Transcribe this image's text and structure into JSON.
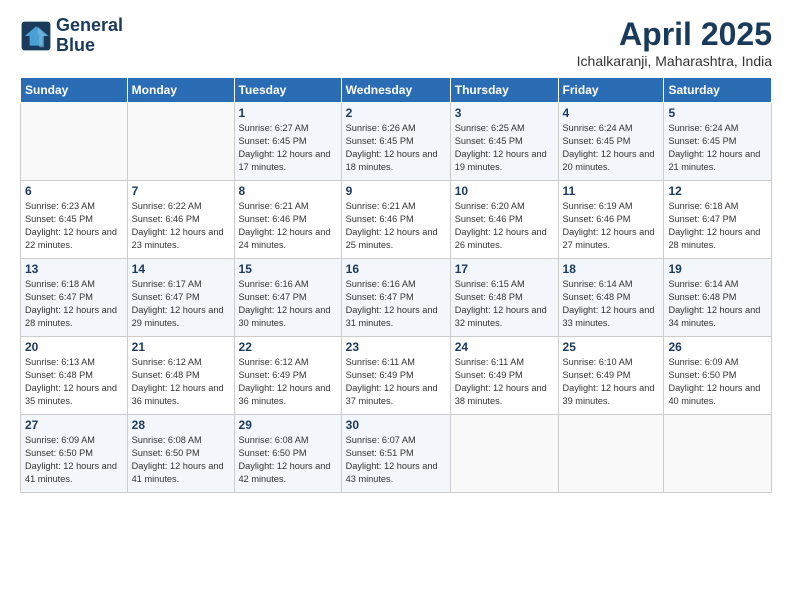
{
  "header": {
    "logo_line1": "General",
    "logo_line2": "Blue",
    "title": "April 2025",
    "subtitle": "Ichalkaranji, Maharashtra, India"
  },
  "days_of_week": [
    "Sunday",
    "Monday",
    "Tuesday",
    "Wednesday",
    "Thursday",
    "Friday",
    "Saturday"
  ],
  "weeks": [
    [
      {
        "num": "",
        "sunrise": "",
        "sunset": "",
        "daylight": ""
      },
      {
        "num": "",
        "sunrise": "",
        "sunset": "",
        "daylight": ""
      },
      {
        "num": "1",
        "sunrise": "Sunrise: 6:27 AM",
        "sunset": "Sunset: 6:45 PM",
        "daylight": "Daylight: 12 hours and 17 minutes."
      },
      {
        "num": "2",
        "sunrise": "Sunrise: 6:26 AM",
        "sunset": "Sunset: 6:45 PM",
        "daylight": "Daylight: 12 hours and 18 minutes."
      },
      {
        "num": "3",
        "sunrise": "Sunrise: 6:25 AM",
        "sunset": "Sunset: 6:45 PM",
        "daylight": "Daylight: 12 hours and 19 minutes."
      },
      {
        "num": "4",
        "sunrise": "Sunrise: 6:24 AM",
        "sunset": "Sunset: 6:45 PM",
        "daylight": "Daylight: 12 hours and 20 minutes."
      },
      {
        "num": "5",
        "sunrise": "Sunrise: 6:24 AM",
        "sunset": "Sunset: 6:45 PM",
        "daylight": "Daylight: 12 hours and 21 minutes."
      }
    ],
    [
      {
        "num": "6",
        "sunrise": "Sunrise: 6:23 AM",
        "sunset": "Sunset: 6:45 PM",
        "daylight": "Daylight: 12 hours and 22 minutes."
      },
      {
        "num": "7",
        "sunrise": "Sunrise: 6:22 AM",
        "sunset": "Sunset: 6:46 PM",
        "daylight": "Daylight: 12 hours and 23 minutes."
      },
      {
        "num": "8",
        "sunrise": "Sunrise: 6:21 AM",
        "sunset": "Sunset: 6:46 PM",
        "daylight": "Daylight: 12 hours and 24 minutes."
      },
      {
        "num": "9",
        "sunrise": "Sunrise: 6:21 AM",
        "sunset": "Sunset: 6:46 PM",
        "daylight": "Daylight: 12 hours and 25 minutes."
      },
      {
        "num": "10",
        "sunrise": "Sunrise: 6:20 AM",
        "sunset": "Sunset: 6:46 PM",
        "daylight": "Daylight: 12 hours and 26 minutes."
      },
      {
        "num": "11",
        "sunrise": "Sunrise: 6:19 AM",
        "sunset": "Sunset: 6:46 PM",
        "daylight": "Daylight: 12 hours and 27 minutes."
      },
      {
        "num": "12",
        "sunrise": "Sunrise: 6:18 AM",
        "sunset": "Sunset: 6:47 PM",
        "daylight": "Daylight: 12 hours and 28 minutes."
      }
    ],
    [
      {
        "num": "13",
        "sunrise": "Sunrise: 6:18 AM",
        "sunset": "Sunset: 6:47 PM",
        "daylight": "Daylight: 12 hours and 28 minutes."
      },
      {
        "num": "14",
        "sunrise": "Sunrise: 6:17 AM",
        "sunset": "Sunset: 6:47 PM",
        "daylight": "Daylight: 12 hours and 29 minutes."
      },
      {
        "num": "15",
        "sunrise": "Sunrise: 6:16 AM",
        "sunset": "Sunset: 6:47 PM",
        "daylight": "Daylight: 12 hours and 30 minutes."
      },
      {
        "num": "16",
        "sunrise": "Sunrise: 6:16 AM",
        "sunset": "Sunset: 6:47 PM",
        "daylight": "Daylight: 12 hours and 31 minutes."
      },
      {
        "num": "17",
        "sunrise": "Sunrise: 6:15 AM",
        "sunset": "Sunset: 6:48 PM",
        "daylight": "Daylight: 12 hours and 32 minutes."
      },
      {
        "num": "18",
        "sunrise": "Sunrise: 6:14 AM",
        "sunset": "Sunset: 6:48 PM",
        "daylight": "Daylight: 12 hours and 33 minutes."
      },
      {
        "num": "19",
        "sunrise": "Sunrise: 6:14 AM",
        "sunset": "Sunset: 6:48 PM",
        "daylight": "Daylight: 12 hours and 34 minutes."
      }
    ],
    [
      {
        "num": "20",
        "sunrise": "Sunrise: 6:13 AM",
        "sunset": "Sunset: 6:48 PM",
        "daylight": "Daylight: 12 hours and 35 minutes."
      },
      {
        "num": "21",
        "sunrise": "Sunrise: 6:12 AM",
        "sunset": "Sunset: 6:48 PM",
        "daylight": "Daylight: 12 hours and 36 minutes."
      },
      {
        "num": "22",
        "sunrise": "Sunrise: 6:12 AM",
        "sunset": "Sunset: 6:49 PM",
        "daylight": "Daylight: 12 hours and 36 minutes."
      },
      {
        "num": "23",
        "sunrise": "Sunrise: 6:11 AM",
        "sunset": "Sunset: 6:49 PM",
        "daylight": "Daylight: 12 hours and 37 minutes."
      },
      {
        "num": "24",
        "sunrise": "Sunrise: 6:11 AM",
        "sunset": "Sunset: 6:49 PM",
        "daylight": "Daylight: 12 hours and 38 minutes."
      },
      {
        "num": "25",
        "sunrise": "Sunrise: 6:10 AM",
        "sunset": "Sunset: 6:49 PM",
        "daylight": "Daylight: 12 hours and 39 minutes."
      },
      {
        "num": "26",
        "sunrise": "Sunrise: 6:09 AM",
        "sunset": "Sunset: 6:50 PM",
        "daylight": "Daylight: 12 hours and 40 minutes."
      }
    ],
    [
      {
        "num": "27",
        "sunrise": "Sunrise: 6:09 AM",
        "sunset": "Sunset: 6:50 PM",
        "daylight": "Daylight: 12 hours and 41 minutes."
      },
      {
        "num": "28",
        "sunrise": "Sunrise: 6:08 AM",
        "sunset": "Sunset: 6:50 PM",
        "daylight": "Daylight: 12 hours and 41 minutes."
      },
      {
        "num": "29",
        "sunrise": "Sunrise: 6:08 AM",
        "sunset": "Sunset: 6:50 PM",
        "daylight": "Daylight: 12 hours and 42 minutes."
      },
      {
        "num": "30",
        "sunrise": "Sunrise: 6:07 AM",
        "sunset": "Sunset: 6:51 PM",
        "daylight": "Daylight: 12 hours and 43 minutes."
      },
      {
        "num": "",
        "sunrise": "",
        "sunset": "",
        "daylight": ""
      },
      {
        "num": "",
        "sunrise": "",
        "sunset": "",
        "daylight": ""
      },
      {
        "num": "",
        "sunrise": "",
        "sunset": "",
        "daylight": ""
      }
    ]
  ]
}
